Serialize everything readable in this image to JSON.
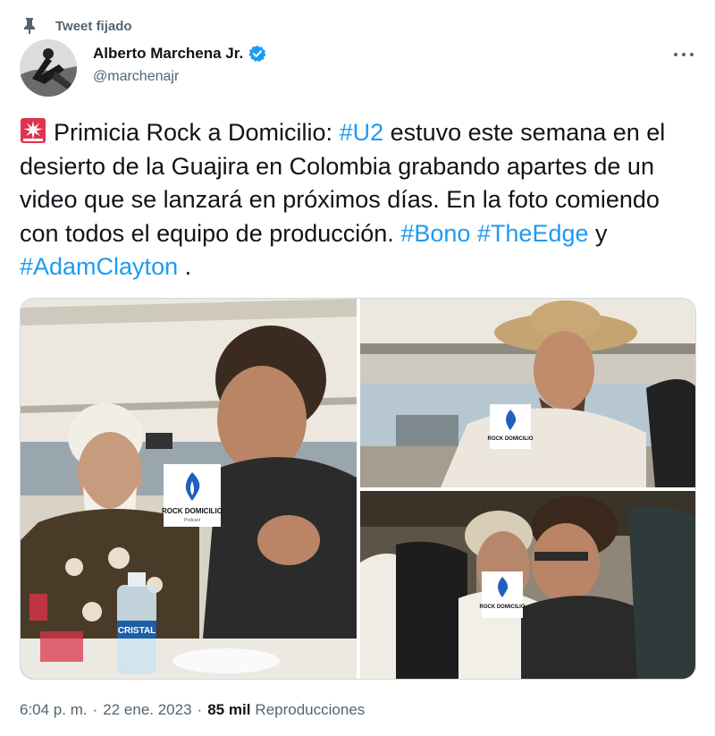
{
  "pinned": {
    "label": "Tweet fijado",
    "icon": "pin-icon"
  },
  "author": {
    "name": "Alberto Marchena Jr.",
    "handle": "@marchenajr",
    "verified": true,
    "verified_color": "#1d9bf0"
  },
  "tweet": {
    "emoji": "rotating-light-icon",
    "t1": "Primicia Rock a Domicilio: ",
    "tag_u2": "#U2",
    "t2": " estuvo este semana en el desierto de la Guajira en Colombia grabando apartes de un video que se lanzará en próximos días. En la foto comiendo con todos el equipo de producción. ",
    "tag_bono": "#Bono",
    "sp1": " ",
    "tag_edge": "#TheEdge",
    "t3": " y ",
    "tag_adam": "#AdamClayton",
    "t4": " ."
  },
  "media": {
    "watermark_line1": "ROCK",
    "watermark_line2": "DOMICILIO",
    "watermark_sub": "Podcast",
    "bottle_label": "CRISTAL"
  },
  "meta": {
    "time": "6:04 p. m.",
    "date": "22 ene. 2023",
    "views_count": "85 mil",
    "views_label": "Reproducciones"
  },
  "colors": {
    "link": "#1d9bf0",
    "secondary": "#536471",
    "text": "#0f1419"
  }
}
